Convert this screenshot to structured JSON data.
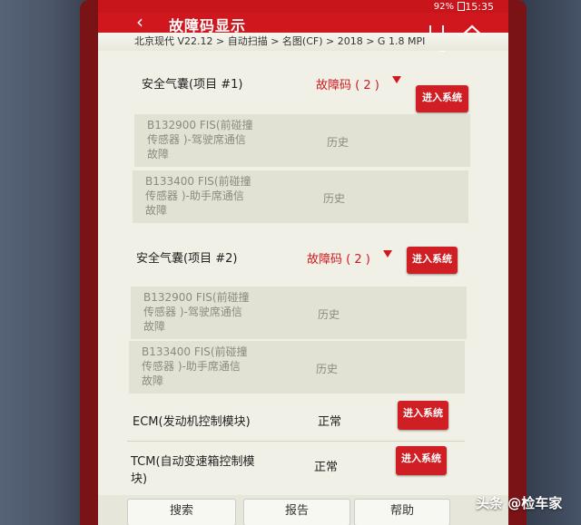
{
  "status": {
    "battery": "92%",
    "time": "15:35"
  },
  "title": "故障码显示",
  "breadcrumb": "北京现代 V22.12 > 自动扫描 > 名图(CF) > 2018 > G 1.8 MPI",
  "enter_label": "进入系统",
  "sections": [
    {
      "name": "安全气囊(项目 #1)",
      "dtc_label": "故障码 ( 2 )",
      "faults": [
        {
          "line1": "B132900 FIS(前碰撞",
          "line2": "传感器 )-驾驶席通信",
          "line3": "故障",
          "state": "历史"
        },
        {
          "line1": "B133400 FIS(前碰撞",
          "line2": "传感器 )-助手席通信",
          "line3": "故障",
          "state": "历史"
        }
      ]
    },
    {
      "name": "安全气囊(项目 #2)",
      "dtc_label": "故障码 ( 2 )",
      "faults": [
        {
          "line1": "B132900 FIS(前碰撞",
          "line2": "传感器 )-驾驶席通信",
          "line3": "故障",
          "state": "历史"
        },
        {
          "line1": "B133400 FIS(前碰撞",
          "line2": "传感器 )-助手席通信",
          "line3": "故障",
          "state": "历史"
        }
      ]
    }
  ],
  "modules": [
    {
      "line1": "ECM(发动机控制模块)",
      "line2": "",
      "state": "正常"
    },
    {
      "line1": "TCM(自动变速箱控制模",
      "line2": "块)",
      "state": "正常"
    }
  ],
  "bottom": {
    "search": "搜索",
    "report": "报告",
    "help": "帮助"
  },
  "watermark": "头条 @检车家",
  "colors": {
    "accent": "#d0171e",
    "button": "#cf1e24",
    "row_bg": "#e2e2d4",
    "screen_bg": "#f0f0e6"
  },
  "icons": {
    "back": "back-arrow-icon",
    "stethoscope": "stethoscope-icon",
    "home": "home-icon",
    "dropdown": "triangle-down-icon"
  }
}
